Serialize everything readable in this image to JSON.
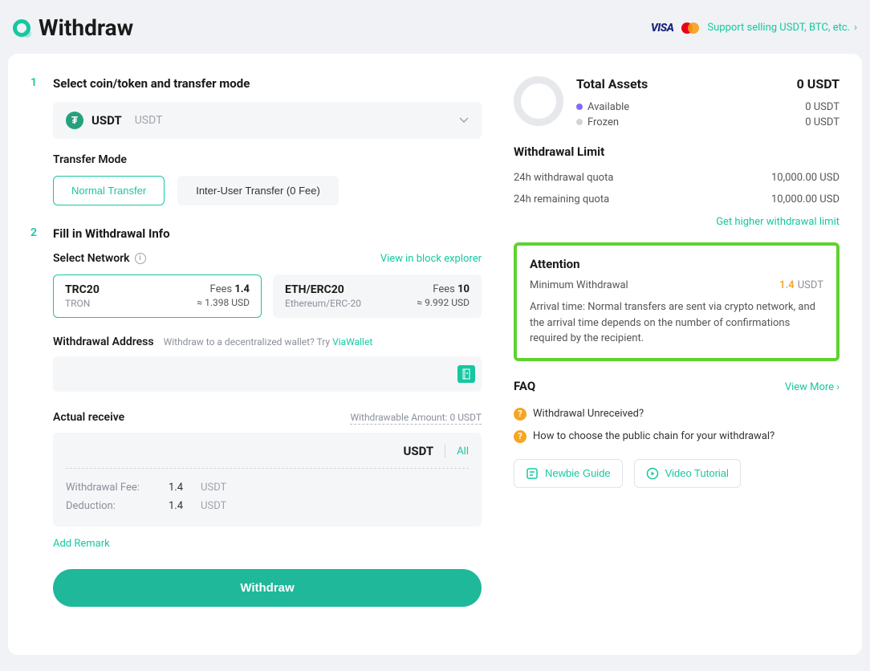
{
  "header": {
    "title": "Withdraw",
    "support_link": "Support selling USDT, BTC, etc."
  },
  "step1": {
    "num": "1",
    "title": "Select coin/token and transfer mode",
    "coin": {
      "icon_letter": "₮",
      "symbol": "USDT",
      "name": "USDT"
    },
    "transfer_mode_label": "Transfer Mode",
    "modes": {
      "normal": "Normal Transfer",
      "interuser": "Inter-User Transfer (0 Fee)"
    }
  },
  "step2": {
    "num": "2",
    "title": "Fill in Withdrawal Info",
    "select_network_label": "Select Network",
    "view_explorer": "View in block explorer",
    "networks": [
      {
        "name": "TRC20",
        "sub": "TRON",
        "fee_label": "Fees ",
        "fee": "1.4",
        "usd": "≈ 1.398 USD"
      },
      {
        "name": "ETH/ERC20",
        "sub": "Ethereum/ERC-20",
        "fee_label": "Fees ",
        "fee": "10",
        "usd": "≈ 9.992 USD"
      }
    ],
    "address_label": "Withdrawal Address",
    "address_hint_prefix": "Withdraw to a decentralized wallet? Try ",
    "address_hint_link": "ViaWallet",
    "receive_label": "Actual receive",
    "withdrawable_prefix": "Withdrawable Amount: ",
    "withdrawable_amount": "0",
    "withdrawable_unit": "USDT",
    "receive_unit": "USDT",
    "all_label": "All",
    "fee_row_label": "Withdrawal Fee:",
    "fee_row_value": "1.4",
    "fee_row_unit": "USDT",
    "deduction_label": "Deduction:",
    "deduction_value": "1.4",
    "deduction_unit": "USDT",
    "add_remark": "Add Remark",
    "submit": "Withdraw"
  },
  "assets": {
    "title": "Total Assets",
    "total": "0 USDT",
    "available_label": "Available",
    "available_value": "0 USDT",
    "frozen_label": "Frozen",
    "frozen_value": "0 USDT"
  },
  "limit": {
    "title": "Withdrawal Limit",
    "quota_label": "24h withdrawal quota",
    "quota_value": "10,000.00 USD",
    "remain_label": "24h remaining quota",
    "remain_value": "10,000.00 USD",
    "higher": "Get higher withdrawal limit"
  },
  "attention": {
    "title": "Attention",
    "min_label": "Minimum Withdrawal",
    "min_value": "1.4",
    "min_unit": "USDT",
    "body": "Arrival time: Normal transfers are sent via crypto network, and the arrival time depends on the number of confirmations required by the recipient."
  },
  "faq": {
    "title": "FAQ",
    "more": "View More",
    "items": [
      "Withdrawal Unreceived?",
      "How to choose the public chain for your withdrawal?"
    ],
    "newbie": "Newbie Guide",
    "video": "Video Tutorial"
  }
}
